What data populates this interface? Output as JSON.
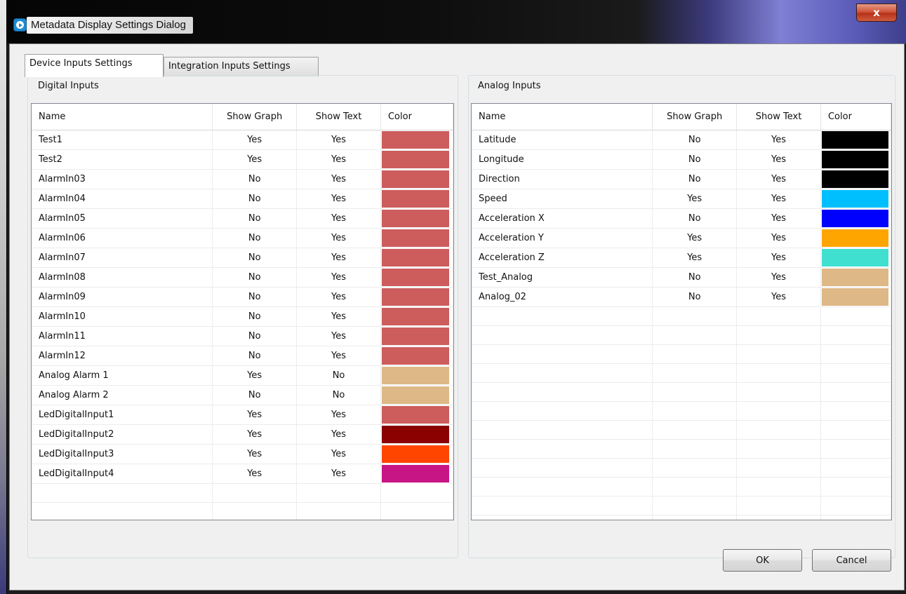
{
  "window": {
    "title": "Metadata Display Settings Dialog",
    "close_label": "x"
  },
  "tabs": [
    {
      "label": "Device Inputs Settings",
      "active": true
    },
    {
      "label": "Integration Inputs Settings",
      "active": false
    }
  ],
  "digital": {
    "group_label": "Digital Inputs",
    "columns": [
      "Name",
      "Show Graph",
      "Show Text",
      "Color"
    ],
    "rows": [
      {
        "name": "Test1",
        "graph": "Yes",
        "text": "Yes",
        "color": "#cd5c5c"
      },
      {
        "name": "Test2",
        "graph": "Yes",
        "text": "Yes",
        "color": "#cd5c5c"
      },
      {
        "name": "AlarmIn03",
        "graph": "No",
        "text": "Yes",
        "color": "#cd5c5c"
      },
      {
        "name": "AlarmIn04",
        "graph": "No",
        "text": "Yes",
        "color": "#cd5c5c"
      },
      {
        "name": "AlarmIn05",
        "graph": "No",
        "text": "Yes",
        "color": "#cd5c5c"
      },
      {
        "name": "AlarmIn06",
        "graph": "No",
        "text": "Yes",
        "color": "#cd5c5c"
      },
      {
        "name": "AlarmIn07",
        "graph": "No",
        "text": "Yes",
        "color": "#cd5c5c"
      },
      {
        "name": "AlarmIn08",
        "graph": "No",
        "text": "Yes",
        "color": "#cd5c5c"
      },
      {
        "name": "AlarmIn09",
        "graph": "No",
        "text": "Yes",
        "color": "#cd5c5c"
      },
      {
        "name": "AlarmIn10",
        "graph": "No",
        "text": "Yes",
        "color": "#cd5c5c"
      },
      {
        "name": "AlarmIn11",
        "graph": "No",
        "text": "Yes",
        "color": "#cd5c5c"
      },
      {
        "name": "AlarmIn12",
        "graph": "No",
        "text": "Yes",
        "color": "#cd5c5c"
      },
      {
        "name": "Analog Alarm 1",
        "graph": "Yes",
        "text": "No",
        "color": "#deb887"
      },
      {
        "name": "Analog Alarm 2",
        "graph": "No",
        "text": "No",
        "color": "#deb887"
      },
      {
        "name": "LedDigitalInput1",
        "graph": "Yes",
        "text": "Yes",
        "color": "#cd5c5c"
      },
      {
        "name": "LedDigitalInput2",
        "graph": "Yes",
        "text": "Yes",
        "color": "#8b0000"
      },
      {
        "name": "LedDigitalInput3",
        "graph": "Yes",
        "text": "Yes",
        "color": "#ff4500"
      },
      {
        "name": "LedDigitalInput4",
        "graph": "Yes",
        "text": "Yes",
        "color": "#c71585"
      }
    ]
  },
  "analog": {
    "group_label": "Analog Inputs",
    "columns": [
      "Name",
      "Show Graph",
      "Show Text",
      "Color"
    ],
    "rows": [
      {
        "name": "Latitude",
        "graph": "No",
        "text": "Yes",
        "color": "#000000"
      },
      {
        "name": "Longitude",
        "graph": "No",
        "text": "Yes",
        "color": "#000000"
      },
      {
        "name": "Direction",
        "graph": "No",
        "text": "Yes",
        "color": "#000000"
      },
      {
        "name": "Speed",
        "graph": "Yes",
        "text": "Yes",
        "color": "#00bfff"
      },
      {
        "name": "Acceleration X",
        "graph": "No",
        "text": "Yes",
        "color": "#0000ff"
      },
      {
        "name": "Acceleration Y",
        "graph": "Yes",
        "text": "Yes",
        "color": "#ffa500"
      },
      {
        "name": "Acceleration Z",
        "graph": "Yes",
        "text": "Yes",
        "color": "#40e0d0"
      },
      {
        "name": "Test_Analog",
        "graph": "No",
        "text": "Yes",
        "color": "#deb887"
      },
      {
        "name": "Analog_02",
        "graph": "No",
        "text": "Yes",
        "color": "#deb887"
      }
    ]
  },
  "buttons": {
    "ok": "OK",
    "cancel": "Cancel"
  }
}
